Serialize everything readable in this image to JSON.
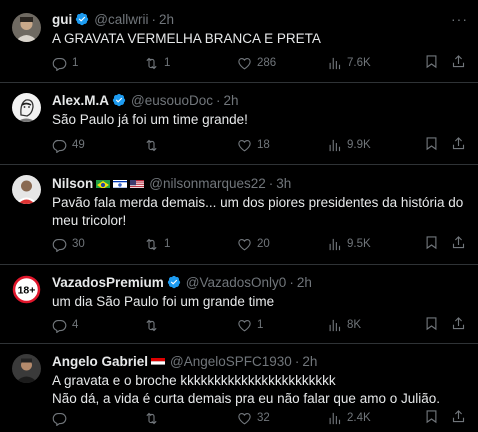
{
  "tweets": [
    {
      "name": "gui",
      "handle": "@callwrii",
      "time": "2h",
      "text": "A GRAVATA VERMELHA BRANCA E PRETA",
      "replies": "1",
      "retweets": "1",
      "likes": "286",
      "views": "7.6K",
      "verified": true,
      "flags": [],
      "avatar": "person-photo"
    },
    {
      "name": "Alex.M.A",
      "handle": "@eusouoDoc",
      "time": "2h",
      "text": "São Paulo já foi um time grande!",
      "replies": "49",
      "retweets": "",
      "likes": "18",
      "views": "9.9K",
      "verified": true,
      "flags": [],
      "avatar": "sketch-portrait"
    },
    {
      "name": "Nilson",
      "handle": "@nilsonmarques22",
      "time": "3h",
      "text": "Pavão fala merda demais... um dos piores presidentes da história do meu tricolor!",
      "replies": "30",
      "retweets": "1",
      "likes": "20",
      "views": "9.5K",
      "verified": false,
      "flags": [
        "brazil-flag",
        "israel-flag",
        "usa-flag"
      ],
      "avatar": "person-photo"
    },
    {
      "name": "VazadosPremium",
      "handle": "@VazadosOnly0",
      "time": "2h",
      "text": "um dia São Paulo foi um grande time",
      "replies": "4",
      "retweets": "",
      "likes": "1",
      "views": "8K",
      "verified": true,
      "flags": [],
      "avatar": "18-plus-badge",
      "avatar_label": "18+"
    },
    {
      "name": "Angelo Gabriel",
      "handle": "@AngeloSPFC1930",
      "time": "2h",
      "text": "A gravata e o broche kkkkkkkkkkkkkkkkkkkkkkk\nNão dá, a vida é curta demais pra eu não falar que amo o Julião.",
      "replies": "",
      "retweets": "",
      "likes": "32",
      "views": "2.4K",
      "verified": false,
      "flags": [
        "sao-paulo-fc-flag"
      ],
      "avatar": "person-photo"
    }
  ],
  "colors": {
    "background": "#000000",
    "text": "#e7e9ea",
    "muted": "#71767b",
    "verified": "#1d9bf0",
    "divider": "#2f3336"
  }
}
